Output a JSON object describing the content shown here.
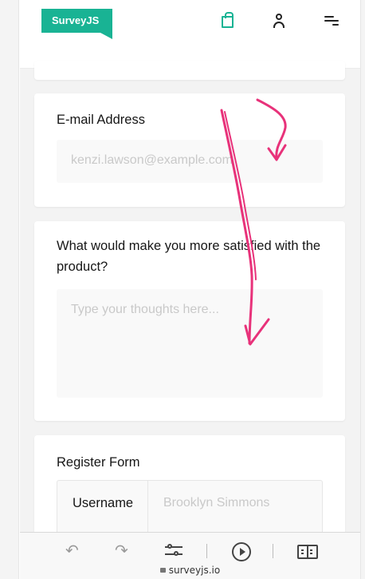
{
  "header": {
    "logo_text": "SurveyJS",
    "icons": [
      "bag-icon",
      "user-icon",
      "menu-icon"
    ]
  },
  "questions": {
    "email": {
      "title": "E-mail Address",
      "placeholder": "kenzi.lawson@example.com"
    },
    "satisfied": {
      "title": "What would make you more satisfied with the product?",
      "placeholder": "Type your thoughts here..."
    },
    "register": {
      "title": "Register Form",
      "username_label": "Username",
      "username_placeholder": "Brooklyn Simmons"
    }
  },
  "browser": {
    "url": "surveyjs.io",
    "icons": [
      "back-icon",
      "forward-icon",
      "settings-icon",
      "play-icon",
      "book-icon"
    ]
  },
  "colors": {
    "accent": "#19b394",
    "annotation": "#e8327a",
    "background": "#f3f3f3"
  }
}
